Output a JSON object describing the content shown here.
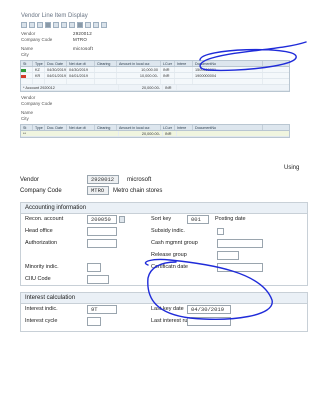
{
  "screen1": {
    "title": "Vendor Line Item Display",
    "fields": [
      {
        "label": "Vendor",
        "value": "2920012",
        "extra": ""
      },
      {
        "label": "Company Code",
        "value": "MTRO",
        "extra": ""
      },
      {
        "label": "Name",
        "value": "microsoft",
        "extra": ""
      },
      {
        "label": "City",
        "value": "",
        "extra": ""
      }
    ],
    "columns": [
      "St",
      "Type",
      "Doc. Date",
      "Net due dt",
      "Clearing",
      "Amount in local cur.",
      "LCurr",
      "Intere",
      "DocumentNo"
    ],
    "rows": [
      {
        "st": "",
        "type": "KZ",
        "docdate": "04/30/2019",
        "netdue": "04/30/2019",
        "clearing": "",
        "amount": "10,000.00",
        "curr": "INR",
        "interest": "",
        "docno": "1500000001"
      },
      {
        "st": "",
        "type": "KR",
        "docdate": "04/01/2019",
        "netdue": "04/01/2019",
        "clearing": "",
        "amount": "10,000.00-",
        "curr": "INR",
        "interest": "",
        "docno": "1900000004"
      },
      {
        "st": "",
        "type": "",
        "docdate": "",
        "netdue": "",
        "clearing": "",
        "amount": "",
        "curr": "",
        "interest": "",
        "docno": ""
      }
    ],
    "subtotal": {
      "label": "* Account 2920012",
      "amount": "20,000.00-",
      "curr": "INR"
    },
    "fields2": [
      {
        "label": "Vendor",
        "value": ""
      },
      {
        "label": "Company Code",
        "value": ""
      },
      {
        "label": "Name",
        "value": ""
      },
      {
        "label": "City",
        "value": ""
      }
    ],
    "total": {
      "label": "**",
      "amount": "20,000.00-",
      "curr": "INR"
    }
  },
  "caption": "Using",
  "screen2": {
    "vendor_label": "Vendor",
    "vendor_value": "2920012",
    "vendor_name": "microsoft",
    "company_label": "Company Code",
    "company_value": "MTRO",
    "company_name": "Metro chain stores",
    "accounting": {
      "title": "Accounting information",
      "recon_label": "Recon. account",
      "recon_value": "200050",
      "sort_key_label": "Sort key",
      "sort_key_value": "001",
      "sort_key_text": "Posting date",
      "head_office_label": "Head office",
      "subsidy_label": "Subsidy indic.",
      "authorization_label": "Authorization",
      "cash_mgmt_label": "Cash mgmnt group",
      "release_group_label": "Release group",
      "minority_label": "Minority indic.",
      "certification_label": "Certificatn date",
      "ciiu_label": "CIIU Code"
    },
    "interest": {
      "title": "Interest calculation",
      "indic_label": "Interest indic.",
      "indic_value": "9T",
      "last_key_label": "Last key date",
      "last_key_value": "04/30/2019",
      "cycle_label": "Interest cycle",
      "last_run_label": "Last interest run"
    }
  },
  "colors": {
    "annotation": "#1f2bd9",
    "header_bg": "#eaf0f6",
    "field_border": "#9aa5ae"
  }
}
